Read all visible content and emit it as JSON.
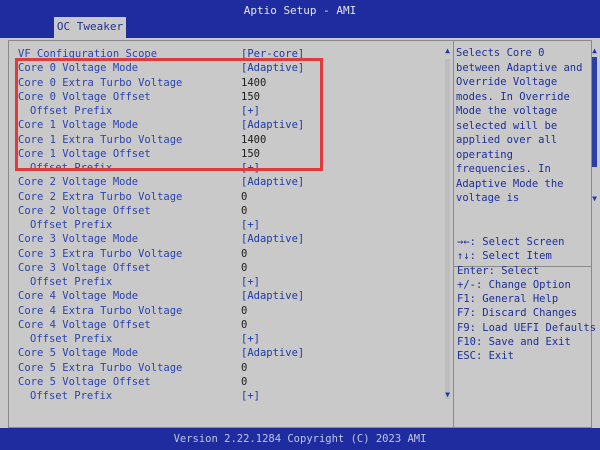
{
  "window": {
    "title": "Aptio Setup - AMI"
  },
  "tab": {
    "label": "OC Tweaker"
  },
  "settings": [
    {
      "label": "VF Configuration Scope",
      "value": "[Per-core]",
      "indent": false
    },
    {
      "label": "Core 0 Voltage Mode",
      "value": "[Adaptive]",
      "indent": false
    },
    {
      "label": "Core 0 Extra Turbo Voltage",
      "value": "1400",
      "indent": false
    },
    {
      "label": "Core 0 Voltage Offset",
      "value": "150",
      "indent": false
    },
    {
      "label": "Offset Prefix",
      "value": "[+]",
      "indent": true
    },
    {
      "label": "Core 1 Voltage Mode",
      "value": "[Adaptive]",
      "indent": false
    },
    {
      "label": "Core 1 Extra Turbo Voltage",
      "value": "1400",
      "indent": false
    },
    {
      "label": "Core 1 Voltage Offset",
      "value": "150",
      "indent": false
    },
    {
      "label": "Offset Prefix",
      "value": "[+]",
      "indent": true
    },
    {
      "label": "Core 2 Voltage Mode",
      "value": "[Adaptive]",
      "indent": false
    },
    {
      "label": "Core 2 Extra Turbo Voltage",
      "value": "0",
      "indent": false
    },
    {
      "label": "Core 2 Voltage Offset",
      "value": "0",
      "indent": false
    },
    {
      "label": "Offset Prefix",
      "value": "[+]",
      "indent": true
    },
    {
      "label": "Core 3 Voltage Mode",
      "value": "[Adaptive]",
      "indent": false
    },
    {
      "label": "Core 3 Extra Turbo Voltage",
      "value": "0",
      "indent": false
    },
    {
      "label": "Core 3 Voltage Offset",
      "value": "0",
      "indent": false
    },
    {
      "label": "Offset Prefix",
      "value": "[+]",
      "indent": true
    },
    {
      "label": "Core 4 Voltage Mode",
      "value": "[Adaptive]",
      "indent": false
    },
    {
      "label": "Core 4 Extra Turbo Voltage",
      "value": "0",
      "indent": false
    },
    {
      "label": "Core 4 Voltage Offset",
      "value": "0",
      "indent": false
    },
    {
      "label": "Offset Prefix",
      "value": "[+]",
      "indent": true
    },
    {
      "label": "Core 5 Voltage Mode",
      "value": "[Adaptive]",
      "indent": false
    },
    {
      "label": "Core 5 Extra Turbo Voltage",
      "value": "0",
      "indent": false
    },
    {
      "label": "Core 5 Voltage Offset",
      "value": "0",
      "indent": false
    },
    {
      "label": "Offset Prefix",
      "value": "[+]",
      "indent": true
    }
  ],
  "help": {
    "text": "Selects Core 0\nbetween Adaptive and\nOverride Voltage\nmodes. In Override\nMode the voltage\nselected will be\napplied over all\noperating\nfrequencies. In\nAdaptive Mode the\nvoltage is"
  },
  "keys": [
    "→←: Select Screen",
    "↑↓: Select Item",
    "Enter: Select",
    "+/-: Change Option",
    "F1: General Help",
    "F7: Discard Changes",
    "F9: Load UEFI Defaults",
    "F10: Save and Exit",
    "ESC: Exit"
  ],
  "scroll": {
    "up": "▲",
    "down": "▼"
  },
  "footer": {
    "text": "Version 2.22.1284 Copyright (C) 2023 AMI"
  },
  "colors": {
    "header": "#1f2ca0",
    "background": "#c9c9c9",
    "highlight": "#e03a3a",
    "label": "#2b43b0"
  }
}
